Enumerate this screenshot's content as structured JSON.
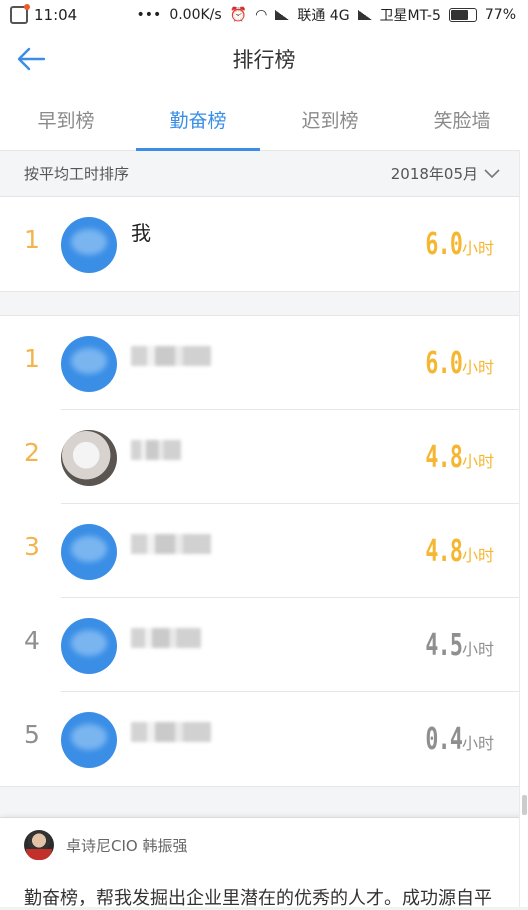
{
  "status_bar": {
    "time": "11:04",
    "net_speed": "0.00K/s",
    "carrier1": "联通 4G",
    "carrier2": "卫星MT-5",
    "battery": "77%",
    "battery_level": 0.77
  },
  "header": {
    "title": "排行榜",
    "back_icon": "arrow-left-icon"
  },
  "tabs": [
    {
      "label": "早到榜",
      "active": false
    },
    {
      "label": "勤奋榜",
      "active": true
    },
    {
      "label": "迟到榜",
      "active": false
    },
    {
      "label": "笑脸墙",
      "active": false
    }
  ],
  "filter": {
    "sort_label": "按平均工时排序",
    "month": "2018年05月",
    "icon": "chevron-down-icon"
  },
  "my_rank": {
    "rank": "1",
    "name": "我",
    "hours": "6.0",
    "unit": "小时"
  },
  "leaderboard": [
    {
      "rank": "1",
      "hours": "6.0",
      "unit": "小时"
    },
    {
      "rank": "2",
      "hours": "4.8",
      "unit": "小时"
    },
    {
      "rank": "3",
      "hours": "4.8",
      "unit": "小时"
    },
    {
      "rank": "4",
      "hours": "4.5",
      "unit": "小时"
    },
    {
      "rank": "5",
      "hours": "0.4",
      "unit": "小时"
    }
  ],
  "testimonial": {
    "author": "卓诗尼CIO 韩振强",
    "text": "勤奋榜，帮我发掘出企业里潜在的优秀的人才。成功源自平"
  },
  "colors": {
    "accent": "#3a8ee6",
    "gold": "#f5b731",
    "grey": "#8f8f8f"
  }
}
